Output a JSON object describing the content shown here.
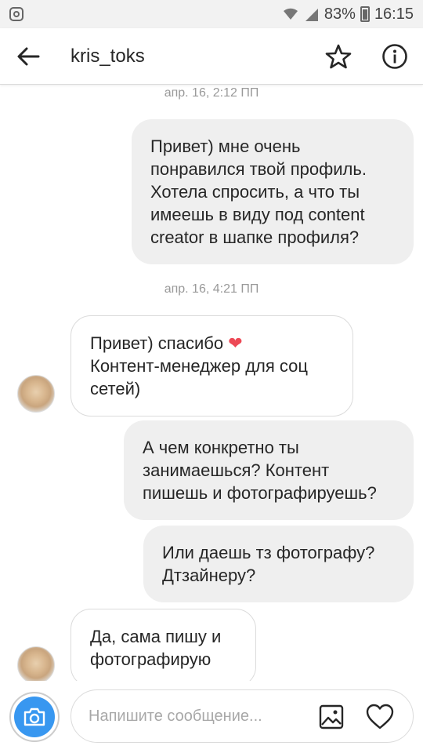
{
  "status_bar": {
    "battery": "83%",
    "time": "16:15"
  },
  "header": {
    "title": "kris_toks"
  },
  "messages": [
    {
      "type": "timestamp",
      "text": "апр. 16, 2:12 ПП"
    },
    {
      "type": "outgoing",
      "lines": [
        "Привет) мне очень",
        "понравился твой профиль.",
        "Хотела спросить, а что ты",
        "имеешь в виду под content",
        "creator в шапке профиля?"
      ]
    },
    {
      "type": "timestamp",
      "text": "апр. 16, 4:21 ПП"
    },
    {
      "type": "incoming",
      "lines": [
        "Привет) спасибо ",
        "Контент-менеджер для соц",
        "сетей)"
      ],
      "emoji": "❤"
    },
    {
      "type": "outgoing",
      "lines": [
        "А чем конкретно ты",
        "занимаешься? Контент",
        "пишешь и фотографируешь?"
      ]
    },
    {
      "type": "outgoing",
      "lines": [
        "Или даешь тз фотографу?",
        "Дтзайнеру?"
      ]
    },
    {
      "type": "incoming",
      "lines": [
        "Да, сама пишу и",
        "фотографирую"
      ]
    }
  ],
  "composer": {
    "placeholder": "Напишите сообщение..."
  },
  "colors": {
    "accent": "#3897f0",
    "outgoing_bubble": "#efefef",
    "heart": "#ed4956"
  },
  "icons": [
    "instagram-icon",
    "wifi-icon",
    "signal-icon",
    "battery-icon",
    "back-arrow-icon",
    "star-icon",
    "info-icon",
    "camera-icon",
    "gallery-icon",
    "heart-icon"
  ]
}
